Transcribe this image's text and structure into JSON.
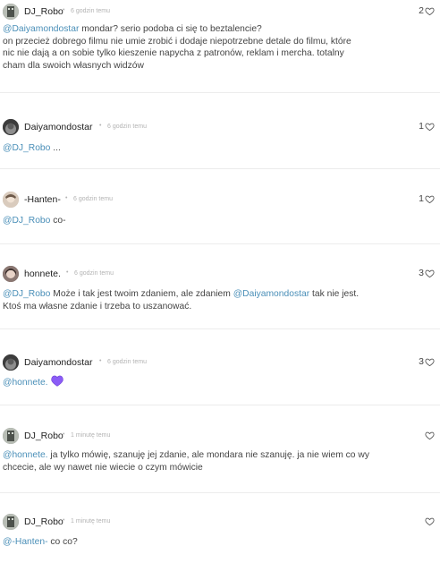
{
  "comments": [
    {
      "username": "DJ_Robo",
      "time": "6 godzin temu",
      "likes": "2",
      "mention": "@Daiyamondostar",
      "text": " mondar? serio podoba ci się to beztalencie?",
      "text2": "on przecież dobrego filmu nie umie zrobić i dodaje niepotrzebne detale do filmu, które",
      "text3": "nic nie dają a on sobie tylko kieszenie napycha z patronów, reklam i mercha. totalny",
      "text4": "cham dla swoich własnych widzów"
    },
    {
      "username": "Daiyamondostar",
      "time": "6 godzin temu",
      "likes": "1",
      "mention": "@DJ_Robo",
      "text": " ..."
    },
    {
      "username": "-Hanten-",
      "time": "6 godzin temu",
      "likes": "1",
      "mention": "@DJ_Robo",
      "text": " co-"
    },
    {
      "username": "honnete.",
      "time": "6 godzin temu",
      "likes": "3",
      "mention": "@DJ_Robo",
      "text": " Może i tak jest twoim zdaniem, ale zdaniem ",
      "mention2": "@Daiyamondostar",
      "text2": " tak nie jest.",
      "text3": "Ktoś ma własne zdanie i trzeba to uszanować."
    },
    {
      "username": "Daiyamondostar",
      "time": "6 godzin temu",
      "likes": "3",
      "mention": "@honnete.",
      "emoji": "purple-heart"
    },
    {
      "username": "DJ_Robo",
      "time": "1 minutę temu",
      "likes": "",
      "mention": "@honnete.",
      "text": " ja tylko mówię, szanuję jej zdanie, ale mondara nie szanuję. ja nie wiem co wy",
      "text2": "chcecie, ale wy nawet nie wiecie o czym mówicie"
    },
    {
      "username": "DJ_Robo",
      "time": "1 minutę temu",
      "likes": "",
      "mention": "@-Hanten-",
      "text": " co co?"
    }
  ],
  "colors": {
    "mention": "#4a8fb8",
    "meta": "#b3b3b3",
    "emoji_heart": "#8b5cf6"
  },
  "icons": {
    "like": "heart-outline-icon",
    "emoji": "purple-heart-icon"
  }
}
